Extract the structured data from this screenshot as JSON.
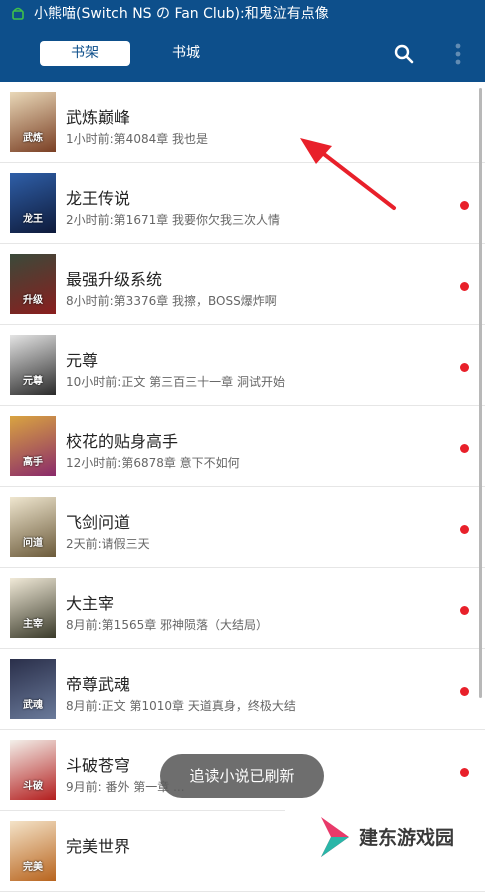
{
  "status_bar": {
    "text": "小熊喵(Switch NS の Fan Club):和鬼泣有点像"
  },
  "header": {
    "tabs": [
      {
        "label": "书架",
        "active": true
      },
      {
        "label": "书城",
        "active": false
      }
    ]
  },
  "books": [
    {
      "title": "武炼巅峰",
      "meta": "1小时前:第4084章 我也是",
      "unread": false,
      "cover_text": "武炼",
      "cover_colors": [
        "#e9d8b8",
        "#7a3f24"
      ]
    },
    {
      "title": "龙王传说",
      "meta": "2小时前:第1671章 我要你欠我三次人情",
      "unread": true,
      "cover_text": "龙王",
      "cover_colors": [
        "#2f5fa8",
        "#0e1a3a"
      ]
    },
    {
      "title": "最强升级系统",
      "meta": "8小时前:第3376章 我擦，BOSS爆炸啊",
      "unread": true,
      "cover_text": "升级",
      "cover_colors": [
        "#3a4a3a",
        "#8a1e1e"
      ]
    },
    {
      "title": "元尊",
      "meta": "10小时前:正文 第三百三十一章 洞试开始",
      "unread": true,
      "cover_text": "元尊",
      "cover_colors": [
        "#e4e4e4",
        "#2a2a2a"
      ]
    },
    {
      "title": "校花的贴身高手",
      "meta": "12小时前:第6878章 意下不如何",
      "unread": true,
      "cover_text": "高手",
      "cover_colors": [
        "#d9a441",
        "#8a2a6a"
      ]
    },
    {
      "title": "飞剑问道",
      "meta": "2天前:请假三天",
      "unread": true,
      "cover_text": "问道",
      "cover_colors": [
        "#efe6cf",
        "#6b5a3a"
      ]
    },
    {
      "title": "大主宰",
      "meta": "8月前:第1565章 邪神陨落（大结局）",
      "unread": true,
      "cover_text": "主宰",
      "cover_colors": [
        "#f1ead8",
        "#3a3a2a"
      ]
    },
    {
      "title": "帝尊武魂",
      "meta": "8月前:正文 第1010章 天道真身，终极大结",
      "unread": true,
      "cover_text": "武魂",
      "cover_colors": [
        "#2a2f4a",
        "#6a7a9a"
      ]
    },
    {
      "title": "斗破苍穹",
      "meta": "9月前: 番外 第一章 ...",
      "unread": true,
      "cover_text": "斗破",
      "cover_colors": [
        "#f3f0ea",
        "#b31e1e"
      ]
    },
    {
      "title": "完美世界",
      "meta": "",
      "unread": false,
      "cover_text": "完美",
      "cover_colors": [
        "#f4e3c8",
        "#b8641e"
      ]
    }
  ],
  "toast": {
    "text": "追读小说已刷新"
  },
  "watermark": {
    "text": "建东游戏园"
  },
  "icons": {
    "status": "android-icon",
    "search": "search-icon",
    "more": "more-vert-icon",
    "annotation": "red-arrow-icon"
  },
  "colors": {
    "app_bar": "#0d4f8b",
    "unread_dot": "#e8202a",
    "annotation_arrow": "#e8202a"
  }
}
